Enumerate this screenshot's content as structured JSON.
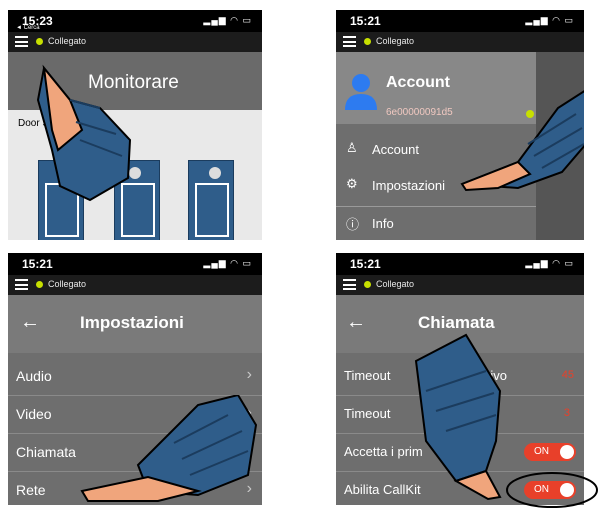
{
  "panel1": {
    "time": "15:23",
    "back_label": "◄ Cerca",
    "connection": "Collegato",
    "title": "Monitorare",
    "door_label": "Door St"
  },
  "panel2": {
    "time": "15:21",
    "connection": "Collegato",
    "account_title": "Account",
    "device_id": "6e00000091d5",
    "menu": [
      {
        "icon": "person-icon",
        "label": "Account"
      },
      {
        "icon": "settings-icon",
        "label": "Impostazioni"
      },
      {
        "icon": "info-icon",
        "label": "Info"
      }
    ]
  },
  "panel3": {
    "time": "15:21",
    "connection": "Collegato",
    "title": "Impostazioni",
    "items": [
      "Audio",
      "Video",
      "Chiamata",
      "Rete"
    ]
  },
  "panel4": {
    "time": "15:21",
    "connection": "Collegato",
    "title": "Chiamata",
    "rows": [
      {
        "label": "Timeout",
        "tail": "rivo",
        "value": "45"
      },
      {
        "label": "Timeout",
        "tail": "",
        "value": "3"
      },
      {
        "label": "Accetta i prim",
        "tail": "a",
        "toggle": "ON"
      },
      {
        "label": "Abilita CallKit",
        "tail": "",
        "toggle": "ON"
      }
    ]
  },
  "colors": {
    "status_dot": "#c7e000",
    "toggle_on": "#e8402a",
    "hand_sleeve": "#2f5d8a",
    "hand_skin": "#f0a57c"
  }
}
